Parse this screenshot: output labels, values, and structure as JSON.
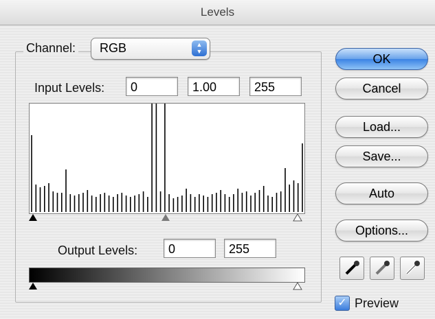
{
  "window": {
    "title": "Levels"
  },
  "channel": {
    "label": "Channel:",
    "value": "RGB"
  },
  "input_levels": {
    "label": "Input Levels:",
    "black": "0",
    "gamma": "1.00",
    "white": "255"
  },
  "output_levels": {
    "label": "Output Levels:",
    "black": "0",
    "white": "255"
  },
  "buttons": {
    "ok": "OK",
    "cancel": "Cancel",
    "load": "Load...",
    "save": "Save...",
    "auto": "Auto",
    "options": "Options..."
  },
  "preview": {
    "label": "Preview",
    "checked": true
  },
  "icons": {
    "black_eyedropper": "eyedropper-black-icon",
    "gray_eyedropper": "eyedropper-gray-icon",
    "white_eyedropper": "eyedropper-white-icon"
  },
  "colors": {
    "default_button": "#3b83e4",
    "checkbox": "#3b7ddd"
  }
}
